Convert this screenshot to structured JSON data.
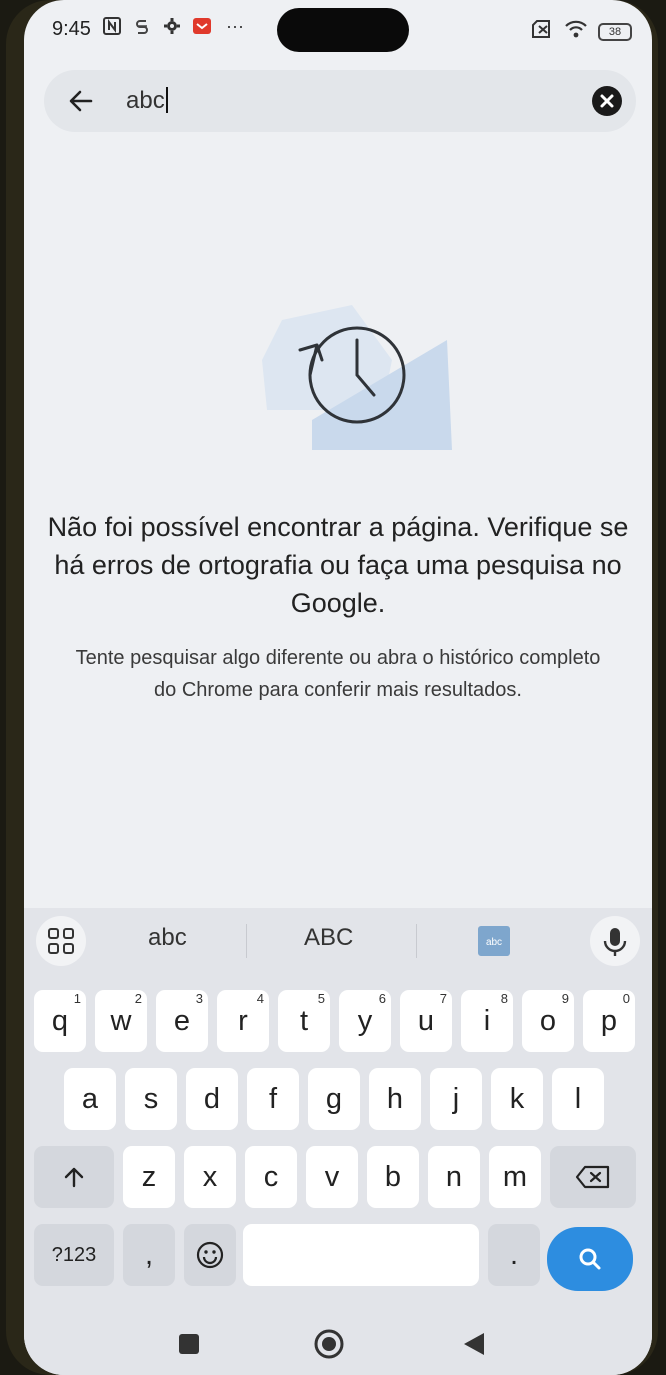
{
  "status": {
    "time": "9:45",
    "left_icons": [
      "nfc-icon",
      "s-app-icon",
      "settings-gear-icon",
      "mail-notification-icon",
      "more-dots-icon"
    ],
    "more": "···",
    "battery": "38"
  },
  "search": {
    "query": "abc"
  },
  "empty_state": {
    "title": "Não foi possível encontrar a página. Verifique se há erros de ortografia ou faça uma pesquisa no Google.",
    "subtitle": "Tente pesquisar algo diferente ou abra o histórico completo do Chrome para conferir mais resultados."
  },
  "keyboard": {
    "suggestions": [
      "abc",
      "ABC"
    ],
    "row1": [
      {
        "k": "q",
        "n": "1"
      },
      {
        "k": "w",
        "n": "2"
      },
      {
        "k": "e",
        "n": "3"
      },
      {
        "k": "r",
        "n": "4"
      },
      {
        "k": "t",
        "n": "5"
      },
      {
        "k": "y",
        "n": "6"
      },
      {
        "k": "u",
        "n": "7"
      },
      {
        "k": "i",
        "n": "8"
      },
      {
        "k": "o",
        "n": "9"
      },
      {
        "k": "p",
        "n": "0"
      }
    ],
    "row2": [
      "a",
      "s",
      "d",
      "f",
      "g",
      "h",
      "j",
      "k",
      "l"
    ],
    "row3": [
      "z",
      "x",
      "c",
      "v",
      "b",
      "n",
      "m"
    ],
    "symbols_label": "?123",
    "comma": ",",
    "period": "."
  },
  "colors": {
    "accent": "#2d8de0",
    "background": "#eef0f3"
  }
}
